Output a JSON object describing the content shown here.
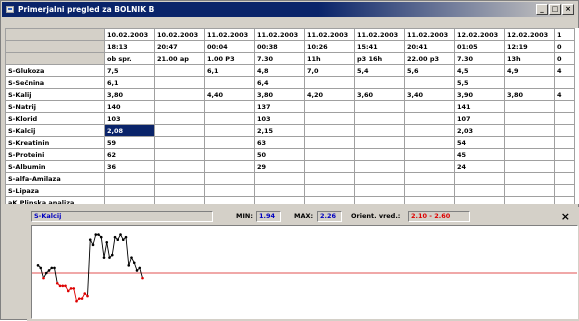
{
  "window": {
    "title": "Primerjalni pregled za BOLNIK B",
    "min_label": "_",
    "max_label": "□",
    "close_label": "×"
  },
  "grid": {
    "headers": [
      [
        "10.02.2003",
        "18:13",
        "ob spr."
      ],
      [
        "10.02.2003",
        "20:47",
        "21.00 ap"
      ],
      [
        "11.02.2003",
        "00:04",
        "1.00 P3"
      ],
      [
        "11.02.2003",
        "00:38",
        "7.30"
      ],
      [
        "11.02.2003",
        "10:26",
        "11h"
      ],
      [
        "11.02.2003",
        "15:41",
        "p3 16h"
      ],
      [
        "11.02.2003",
        "20:41",
        "22.00 p3"
      ],
      [
        "12.02.2003",
        "01:05",
        "7.30"
      ],
      [
        "12.02.2003",
        "12:19",
        "13h"
      ],
      [
        "1",
        "0",
        "0"
      ]
    ],
    "rows": [
      {
        "name": "S-Glukoza",
        "values": [
          "7,5",
          "",
          "6,1",
          "4,8",
          "7,0",
          "5,4",
          "5,6",
          "4,5",
          "4,9",
          "4"
        ]
      },
      {
        "name": "S-Sečnina",
        "values": [
          "6,1",
          "",
          "",
          "6,4",
          "",
          "",
          "",
          "5,5",
          "",
          ""
        ]
      },
      {
        "name": "S-Kalij",
        "values": [
          "3,80",
          "",
          "4,40",
          "3,80",
          "4,20",
          "3,60",
          "3,40",
          "3,90",
          "3,80",
          "4"
        ]
      },
      {
        "name": "S-Natrij",
        "values": [
          "140",
          "",
          "",
          "137",
          "",
          "",
          "",
          "141",
          "",
          ""
        ]
      },
      {
        "name": "S-Klorid",
        "values": [
          "103",
          "",
          "",
          "103",
          "",
          "",
          "",
          "107",
          "",
          ""
        ]
      },
      {
        "name": "S-Kalcij",
        "values": [
          "2,08",
          "",
          "",
          "2,15",
          "",
          "",
          "",
          "2,03",
          "",
          ""
        ]
      },
      {
        "name": "S-Kreatinin",
        "values": [
          "59",
          "",
          "",
          "63",
          "",
          "",
          "",
          "54",
          "",
          ""
        ]
      },
      {
        "name": "S-Proteini",
        "values": [
          "62",
          "",
          "",
          "50",
          "",
          "",
          "",
          "45",
          "",
          ""
        ]
      },
      {
        "name": "S-Albumin",
        "values": [
          "36",
          "",
          "",
          "29",
          "",
          "",
          "",
          "24",
          "",
          ""
        ]
      },
      {
        "name": "S-alfa-Amilaza",
        "values": [
          "",
          "",
          "",
          "",
          "",
          "",
          "",
          "",
          "",
          ""
        ]
      },
      {
        "name": "S-Lipaza",
        "values": [
          "",
          "",
          "",
          "",
          "",
          "",
          "",
          "",
          "",
          ""
        ]
      },
      {
        "name": "aK Plinska analiza",
        "values": [
          "",
          "",
          "",
          "",
          "",
          "",
          "",
          "",
          "",
          ""
        ]
      }
    ],
    "selected": {
      "row": 5,
      "col": 0
    }
  },
  "panel": {
    "analyte": "S-Kalcij",
    "min_label": "MIN:",
    "min_value": "1.94",
    "max_label": "MAX:",
    "max_value": "2.26",
    "ref_label": "Orient. vred.:",
    "ref_value": "2.10 - 2.60",
    "close": "×",
    "accent_red": "#dd0000",
    "value_blue": "#0000c0"
  },
  "chart_data": {
    "type": "line",
    "title": "",
    "ylim": [
      1.94,
      2.26
    ],
    "reference_line": 2.1,
    "values": [
      2.13,
      2.12,
      2.08,
      2.1,
      2.11,
      2.12,
      2.12,
      2.06,
      2.05,
      2.05,
      2.05,
      2.03,
      2.04,
      2.04,
      1.99,
      2.0,
      2.0,
      2.02,
      2.01,
      2.23,
      2.21,
      2.25,
      2.25,
      2.24,
      2.16,
      2.22,
      2.16,
      2.17,
      2.24,
      2.23,
      2.25,
      2.23,
      2.24,
      2.13,
      2.16,
      2.14,
      2.11,
      2.12,
      2.08
    ]
  }
}
